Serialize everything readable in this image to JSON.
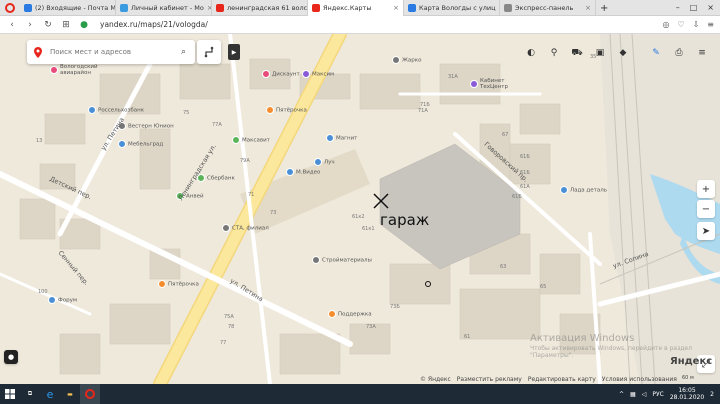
{
  "browser": {
    "tabs": [
      {
        "title": "(2) Входящие - Почта М",
        "color": "#2a7ae2"
      },
      {
        "title": "Личный кабинет - Мо",
        "color": "#3a9be0"
      },
      {
        "title": "ленинградская 61 волс",
        "color": "#e8261c"
      },
      {
        "title": "Яндекс.Карты",
        "color": "#e8261c"
      },
      {
        "title": "Карта Вологды с улиц",
        "color": "#2a7ae2"
      },
      {
        "title": "Экспресс-панель",
        "color": "#888888"
      }
    ],
    "url": "yandex.ru/maps/21/vologda/",
    "new_tab": "+"
  },
  "map": {
    "search_placeholder": "Поиск мест и адресов",
    "annotation": "гараж",
    "pois": [
      {
        "name": "Вологодский\nавиарайон",
        "color": "#e84b7a"
      },
      {
        "name": "Россельхозбанк",
        "color": "#4a8fd6"
      },
      {
        "name": "Вестерн Юнион",
        "color": "#777777"
      },
      {
        "name": "Мебельград",
        "color": "#4a8fd6"
      },
      {
        "name": "Дискаунт",
        "color": "#e84b7a"
      },
      {
        "name": "Максим",
        "color": "#8a5ad6"
      },
      {
        "name": "Пятёрочка",
        "color": "#f58c2e"
      },
      {
        "name": "Максавит",
        "color": "#5bb35a"
      },
      {
        "name": "Магнит",
        "color": "#4a8fd6"
      },
      {
        "name": "Сбербанк",
        "color": "#5bb35a"
      },
      {
        "name": "М.Видео",
        "color": "#4a8fd6"
      },
      {
        "name": "Луч",
        "color": "#4a8fd6"
      },
      {
        "name": "Анвей",
        "color": "#5bb35a"
      },
      {
        "name": "СТА, филиал",
        "color": "#777777"
      },
      {
        "name": "Стройматериалы",
        "color": "#777777"
      },
      {
        "name": "Пятёрочка",
        "color": "#f58c2e"
      },
      {
        "name": "Форум",
        "color": "#4a8fd6"
      },
      {
        "name": "Поддержка",
        "color": "#f58c2e"
      },
      {
        "name": "Жарко",
        "color": "#777777"
      },
      {
        "name": "Кабинет\nТехЦентр",
        "color": "#8a5ad6"
      },
      {
        "name": "Лада деталь",
        "color": "#4a8fd6"
      }
    ],
    "streets": [
      "ул. Петина",
      "Ленинградская ул.",
      "ул. Петина",
      "Говоровский пр.",
      "Детский пер.",
      "Сенный пер.",
      "ул. Сопина"
    ],
    "house_numbers": [
      "75",
      "77А",
      "71",
      "79А",
      "73",
      "13",
      "61",
      "61А",
      "63",
      "65",
      "71Б",
      "61Б",
      "71А",
      "31А",
      "67",
      "73А",
      "73Б",
      "78",
      "77",
      "75А",
      "100",
      "35",
      "61к1",
      "61к2",
      "61Б",
      "61Б"
    ],
    "footer_links": [
      "© Яндекс",
      "Разместить рекламу",
      "Редактировать карту",
      "Условия использования"
    ],
    "watermark_title": "Активация Windows",
    "watermark_text": "Чтобы активировать Windows, перейдите в раздел \"Параметры\".",
    "logo": "Яндекс",
    "scale": "60 м"
  },
  "taskbar": {
    "lang": "РУС",
    "time": "16:05",
    "date": "28.01.2020",
    "notif": "2"
  }
}
